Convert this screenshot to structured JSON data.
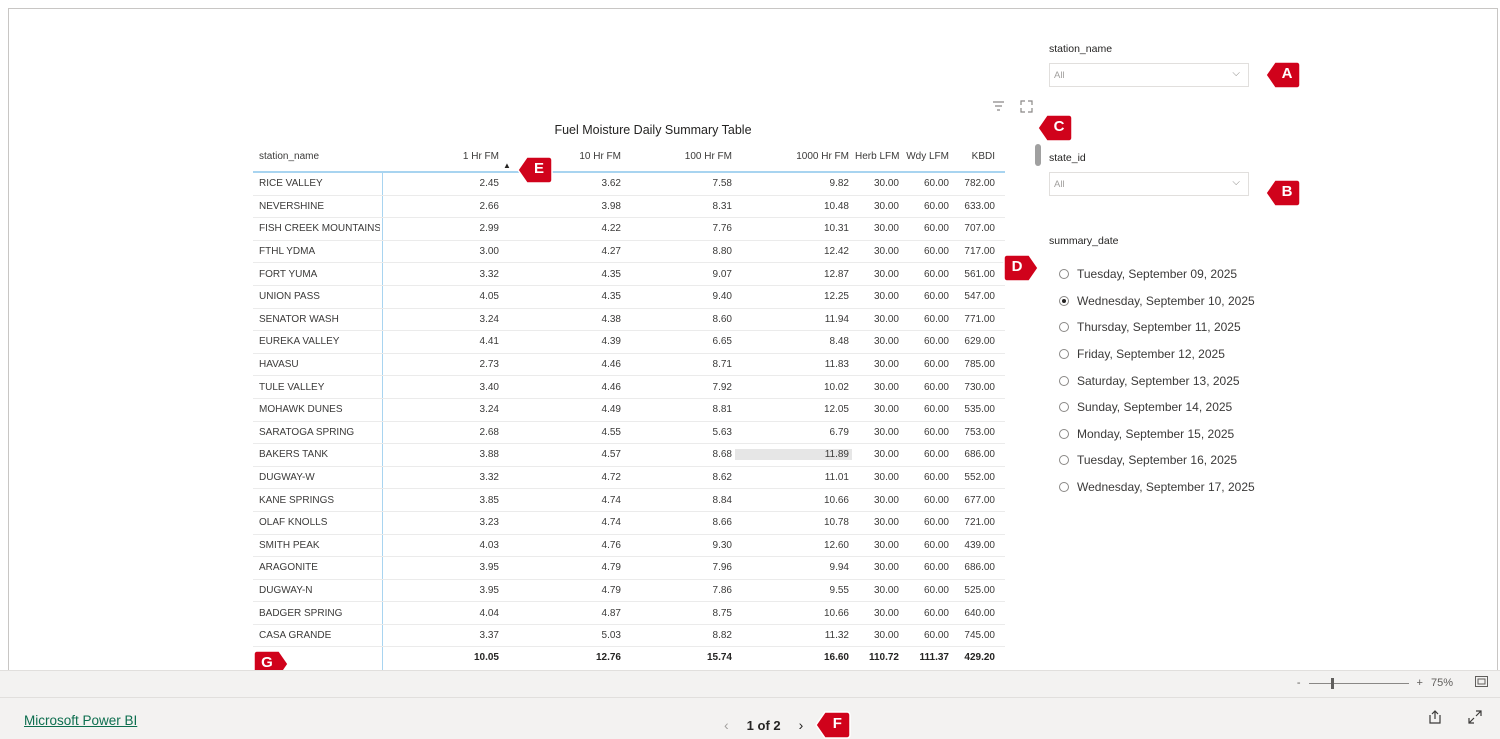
{
  "table": {
    "title": "Fuel Moisture Daily Summary Table",
    "columns": [
      "station_name",
      "1 Hr FM",
      "10 Hr FM",
      "100 Hr FM",
      "1000 Hr FM",
      "Herb LFM",
      "Wdy LFM",
      "KBDI"
    ],
    "rows": [
      [
        "RICE VALLEY",
        "2.45",
        "3.62",
        "7.58",
        "9.82",
        "30.00",
        "60.00",
        "782.00"
      ],
      [
        "NEVERSHINE",
        "2.66",
        "3.98",
        "8.31",
        "10.48",
        "30.00",
        "60.00",
        "633.00"
      ],
      [
        "FISH CREEK MOUNTAINS",
        "2.99",
        "4.22",
        "7.76",
        "10.31",
        "30.00",
        "60.00",
        "707.00"
      ],
      [
        "FTHL YDMA",
        "3.00",
        "4.27",
        "8.80",
        "12.42",
        "30.00",
        "60.00",
        "717.00"
      ],
      [
        "FORT YUMA",
        "3.32",
        "4.35",
        "9.07",
        "12.87",
        "30.00",
        "60.00",
        "561.00"
      ],
      [
        "UNION PASS",
        "4.05",
        "4.35",
        "9.40",
        "12.25",
        "30.00",
        "60.00",
        "547.00"
      ],
      [
        "SENATOR WASH",
        "3.24",
        "4.38",
        "8.60",
        "11.94",
        "30.00",
        "60.00",
        "771.00"
      ],
      [
        "EUREKA VALLEY",
        "4.41",
        "4.39",
        "6.65",
        "8.48",
        "30.00",
        "60.00",
        "629.00"
      ],
      [
        "HAVASU",
        "2.73",
        "4.46",
        "8.71",
        "11.83",
        "30.00",
        "60.00",
        "785.00"
      ],
      [
        "TULE VALLEY",
        "3.40",
        "4.46",
        "7.92",
        "10.02",
        "30.00",
        "60.00",
        "730.00"
      ],
      [
        "MOHAWK DUNES",
        "3.24",
        "4.49",
        "8.81",
        "12.05",
        "30.00",
        "60.00",
        "535.00"
      ],
      [
        "SARATOGA SPRING",
        "2.68",
        "4.55",
        "5.63",
        "6.79",
        "30.00",
        "60.00",
        "753.00"
      ],
      [
        "BAKERS TANK",
        "3.88",
        "4.57",
        "8.68",
        "11.89",
        "30.00",
        "60.00",
        "686.00"
      ],
      [
        "DUGWAY-W",
        "3.32",
        "4.72",
        "8.62",
        "11.01",
        "30.00",
        "60.00",
        "552.00"
      ],
      [
        "KANE SPRINGS",
        "3.85",
        "4.74",
        "8.84",
        "10.66",
        "30.00",
        "60.00",
        "677.00"
      ],
      [
        "OLAF KNOLLS",
        "3.23",
        "4.74",
        "8.66",
        "10.78",
        "30.00",
        "60.00",
        "721.00"
      ],
      [
        "SMITH PEAK",
        "4.03",
        "4.76",
        "9.30",
        "12.60",
        "30.00",
        "60.00",
        "439.00"
      ],
      [
        "ARAGONITE",
        "3.95",
        "4.79",
        "7.96",
        "9.94",
        "30.00",
        "60.00",
        "686.00"
      ],
      [
        "DUGWAY-N",
        "3.95",
        "4.79",
        "7.86",
        "9.55",
        "30.00",
        "60.00",
        "525.00"
      ],
      [
        "BADGER SPRING",
        "4.04",
        "4.87",
        "8.75",
        "10.66",
        "30.00",
        "60.00",
        "640.00"
      ],
      [
        "CASA GRANDE",
        "3.37",
        "5.03",
        "8.82",
        "11.32",
        "30.00",
        "60.00",
        "745.00"
      ]
    ],
    "totals": [
      "",
      "10.05",
      "12.76",
      "15.74",
      "16.60",
      "110.72",
      "111.37",
      "429.20"
    ],
    "highlighted_cell": {
      "row": 12,
      "col": 4
    },
    "sorted_column_index": 1,
    "sort_direction": "ascending"
  },
  "visual_header": {
    "filter_icon": "filter-icon",
    "focus_icon": "focus-mode-icon"
  },
  "slicers": {
    "station": {
      "title": "station_name",
      "value": "All"
    },
    "state": {
      "title": "state_id",
      "value": "All"
    },
    "date": {
      "title": "summary_date",
      "options": [
        {
          "label": "Tuesday, September 09, 2025",
          "selected": false
        },
        {
          "label": "Wednesday, September 10, 2025",
          "selected": true
        },
        {
          "label": "Thursday, September 11, 2025",
          "selected": false
        },
        {
          "label": "Friday, September 12, 2025",
          "selected": false
        },
        {
          "label": "Saturday, September 13, 2025",
          "selected": false
        },
        {
          "label": "Sunday, September 14, 2025",
          "selected": false
        },
        {
          "label": "Monday, September 15, 2025",
          "selected": false
        },
        {
          "label": "Tuesday, September 16, 2025",
          "selected": false
        },
        {
          "label": "Wednesday, September 17, 2025",
          "selected": false
        }
      ]
    }
  },
  "markers": [
    "A",
    "B",
    "C",
    "D",
    "E",
    "F",
    "G"
  ],
  "zoom": {
    "minus": "-",
    "plus": "+",
    "level": "75%"
  },
  "footer": {
    "brand": "Microsoft Power BI",
    "page_label": "1 of 2",
    "prev": "‹",
    "next": "›"
  },
  "colors": {
    "marker": "#d0021b",
    "brand_link": "#0d6e4f",
    "header_rule": "#a8d4f0"
  }
}
